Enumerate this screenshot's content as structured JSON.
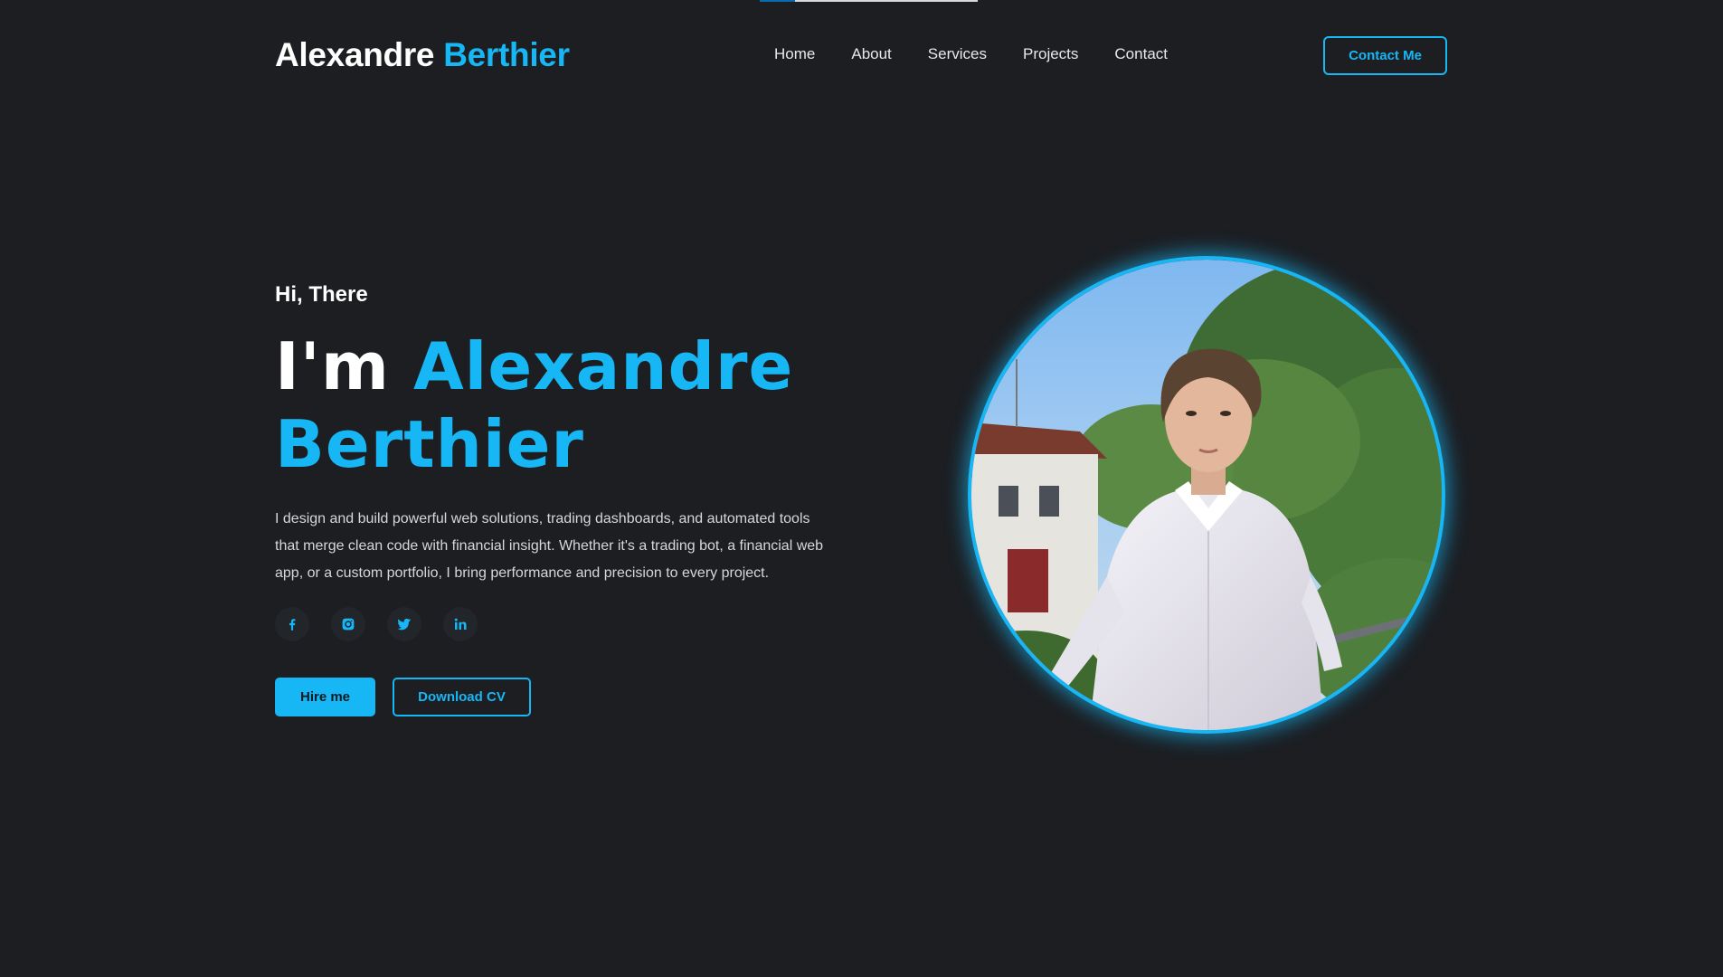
{
  "brand": {
    "first_name": "Alexandre",
    "last_name": "Berthier",
    "accent_color": "#17b7f5",
    "background_color": "#1c1e22"
  },
  "nav": {
    "items": [
      {
        "label": "Home"
      },
      {
        "label": "About"
      },
      {
        "label": "Services"
      },
      {
        "label": "Projects"
      },
      {
        "label": "Contact"
      }
    ],
    "contact_button": "Contact Me"
  },
  "hero": {
    "greeting": "Hi, There",
    "headline_prefix": "I'm",
    "headline_first": "Alexandre",
    "headline_last": "Berthier",
    "intro": "I design and build powerful web solutions, trading dashboards, and automated tools that merge clean code with financial insight. Whether it's a trading bot, a financial web app, or a custom portfolio, I bring performance and precision to every project.",
    "socials": [
      {
        "icon": "facebook-icon"
      },
      {
        "icon": "instagram-icon"
      },
      {
        "icon": "twitter-icon"
      },
      {
        "icon": "linkedin-icon"
      }
    ],
    "primary_button": "Hire me",
    "secondary_button": "Download CV"
  },
  "scroll_progress": 0.16
}
